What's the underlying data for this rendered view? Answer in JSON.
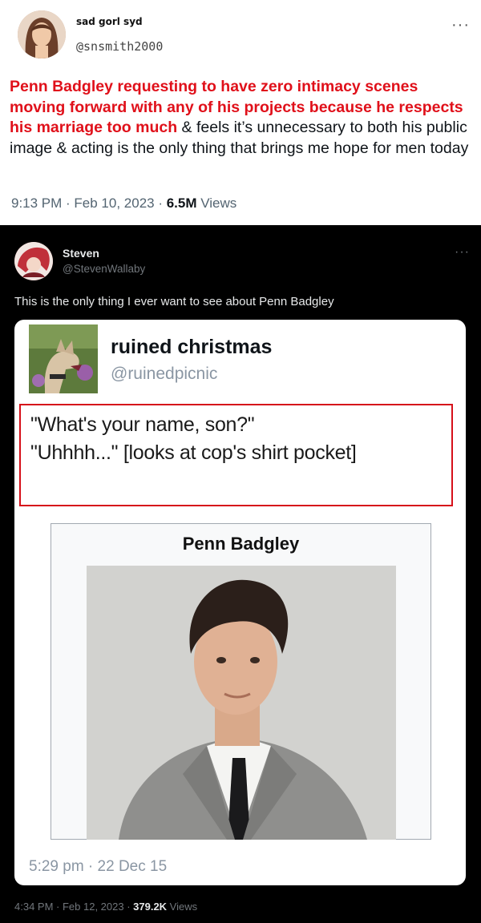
{
  "top_tweet": {
    "author_name": "sad gorl syd",
    "author_handle": "@snsmith2000",
    "more_label": "···",
    "text_highlight": "Penn Badgley requesting to have zero intimacy scenes moving forward with any of his projects because he respects his marriage too much",
    "text_rest": " & feels it’s unnecessary to both his public image & acting is the only thing that brings me hope for men today",
    "timestamp": "9:13 PM · Feb 10, 2023 · ",
    "views_count": "6.5M",
    "views_label": " Views",
    "highlight_color": "#e0101a"
  },
  "reply_tweet": {
    "author_name": "Steven",
    "author_handle": "@StevenWallaby",
    "more_label": "···",
    "text": "This is the only thing I ever want to see about Penn Badgley",
    "timestamp": "4:34 PM · Feb 12, 2023 · ",
    "views_count": "379.2K",
    "views_label": " Views"
  },
  "embedded_card": {
    "author_name": "ruined christmas",
    "author_handle": "@ruinedpicnic",
    "quote_line_1": "\"What's your name, son?\"",
    "quote_line_2": "\"Uhhhh...\" [looks at cop's shirt pocket]",
    "wiki_title": "Penn Badgley",
    "timestamp": "5:29 pm · 22 Dec 15",
    "frame_color": "#d6101a"
  }
}
